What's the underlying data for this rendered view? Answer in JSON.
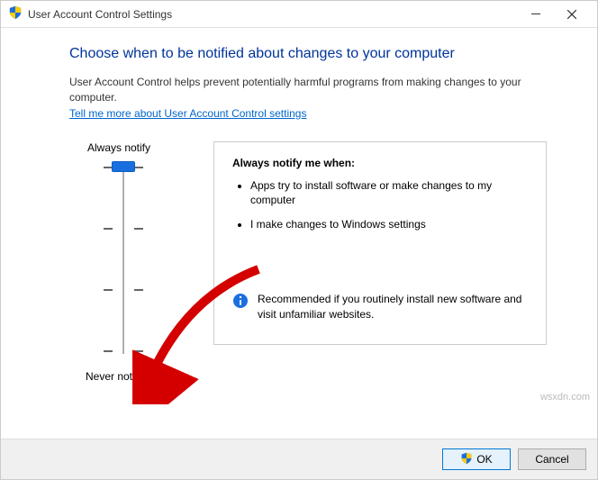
{
  "window": {
    "title": "User Account Control Settings"
  },
  "main": {
    "heading": "Choose when to be notified about changes to your computer",
    "desc": "User Account Control helps prevent potentially harmful programs from making changes to your computer.",
    "link": "Tell me more about User Account Control settings"
  },
  "slider": {
    "top_label": "Always notify",
    "bottom_label": "Never notify",
    "levels": 4,
    "current_level": 0
  },
  "detail": {
    "title": "Always notify me when:",
    "bullets": [
      "Apps try to install software or make changes to my computer",
      "I make changes to Windows settings"
    ],
    "info": "Recommended if you routinely install new software and visit unfamiliar websites."
  },
  "buttons": {
    "ok": "OK",
    "cancel": "Cancel"
  },
  "icons": {
    "shield": "shield-icon",
    "info": "info-icon",
    "minimize": "minimize-icon",
    "close": "close-icon"
  },
  "watermark": "wsxdn.com"
}
